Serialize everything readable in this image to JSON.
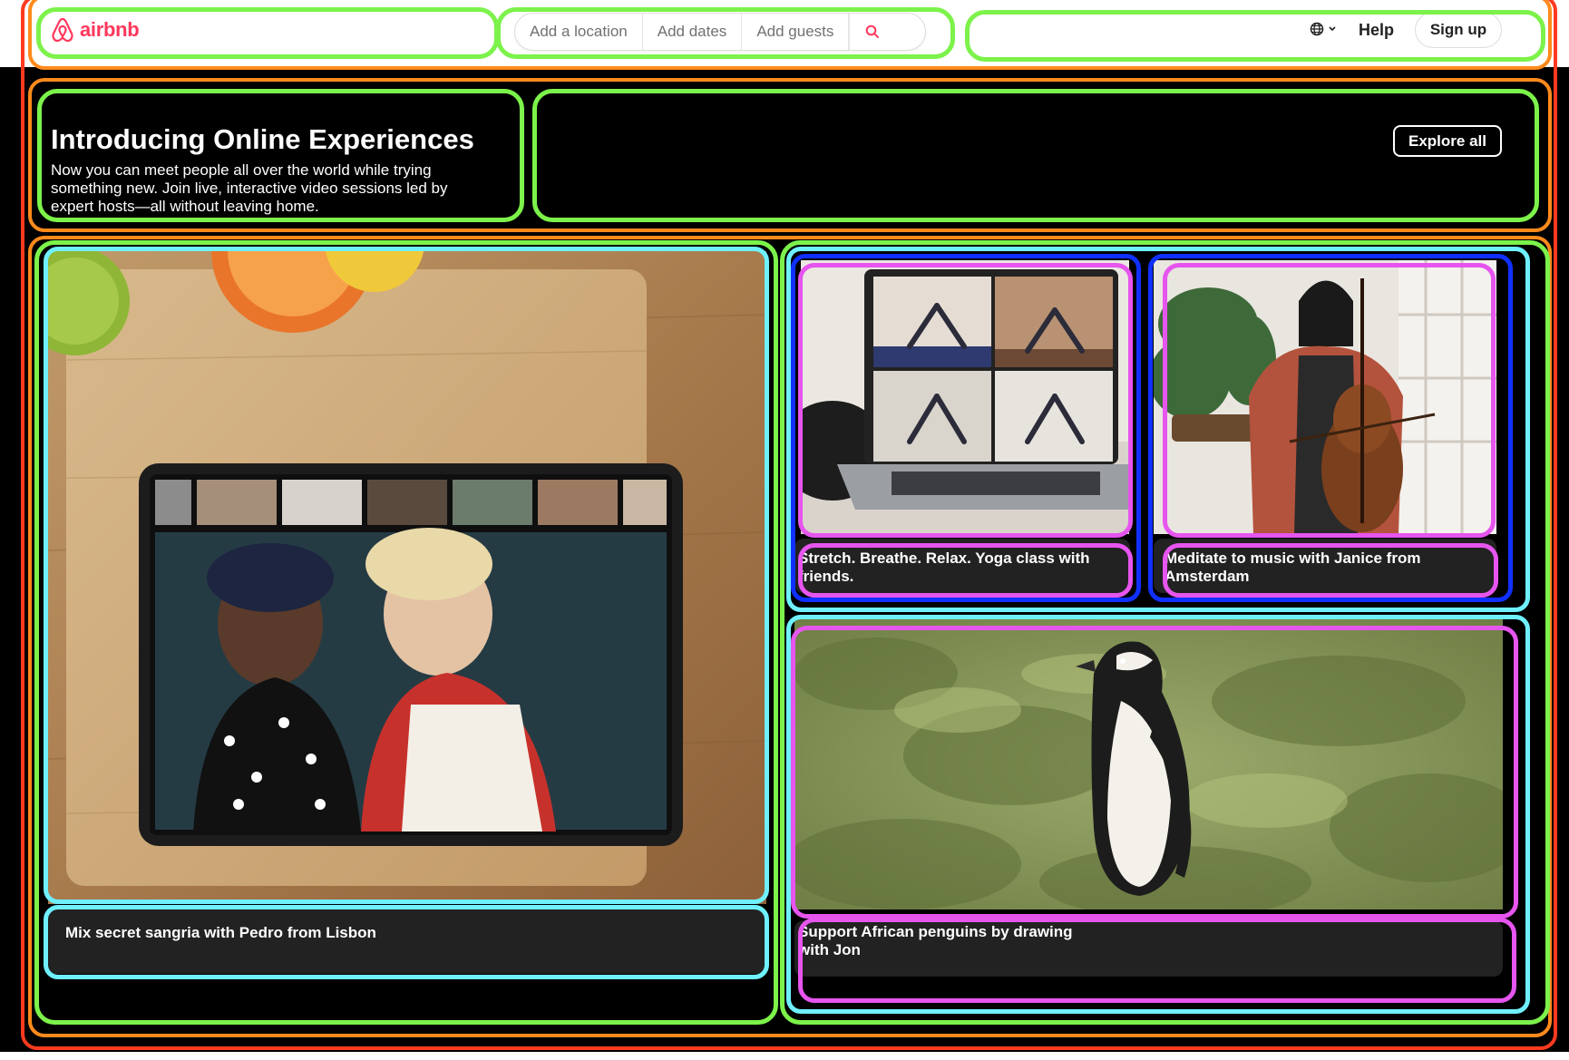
{
  "header": {
    "brand": "airbnb",
    "search": {
      "location_placeholder": "Add a location",
      "dates_placeholder": "Add dates",
      "guests_placeholder": "Add guests",
      "search_icon": "search-icon"
    },
    "language_icon": "globe-icon",
    "help_label": "Help",
    "signup_label": "Sign up"
  },
  "hero": {
    "title": "Introducing Online Experiences",
    "body": "Now you can meet people all over the world while trying something new. Join live, interactive video sessions led by expert hosts—all without leaving home.",
    "cta_label": "Explore all"
  },
  "experiences": [
    {
      "caption": "Mix secret sangria with Pedro from Lisbon"
    },
    {
      "caption": "Stretch. Breathe. Relax. Yoga class with friends."
    },
    {
      "caption": "Meditate to music with Janice from Amsterdam"
    },
    {
      "caption": "Support African penguins by drawing with Jon"
    }
  ],
  "colors": {
    "brand": "#ff385c",
    "background": "#000000",
    "caption_bg": "#222222"
  }
}
